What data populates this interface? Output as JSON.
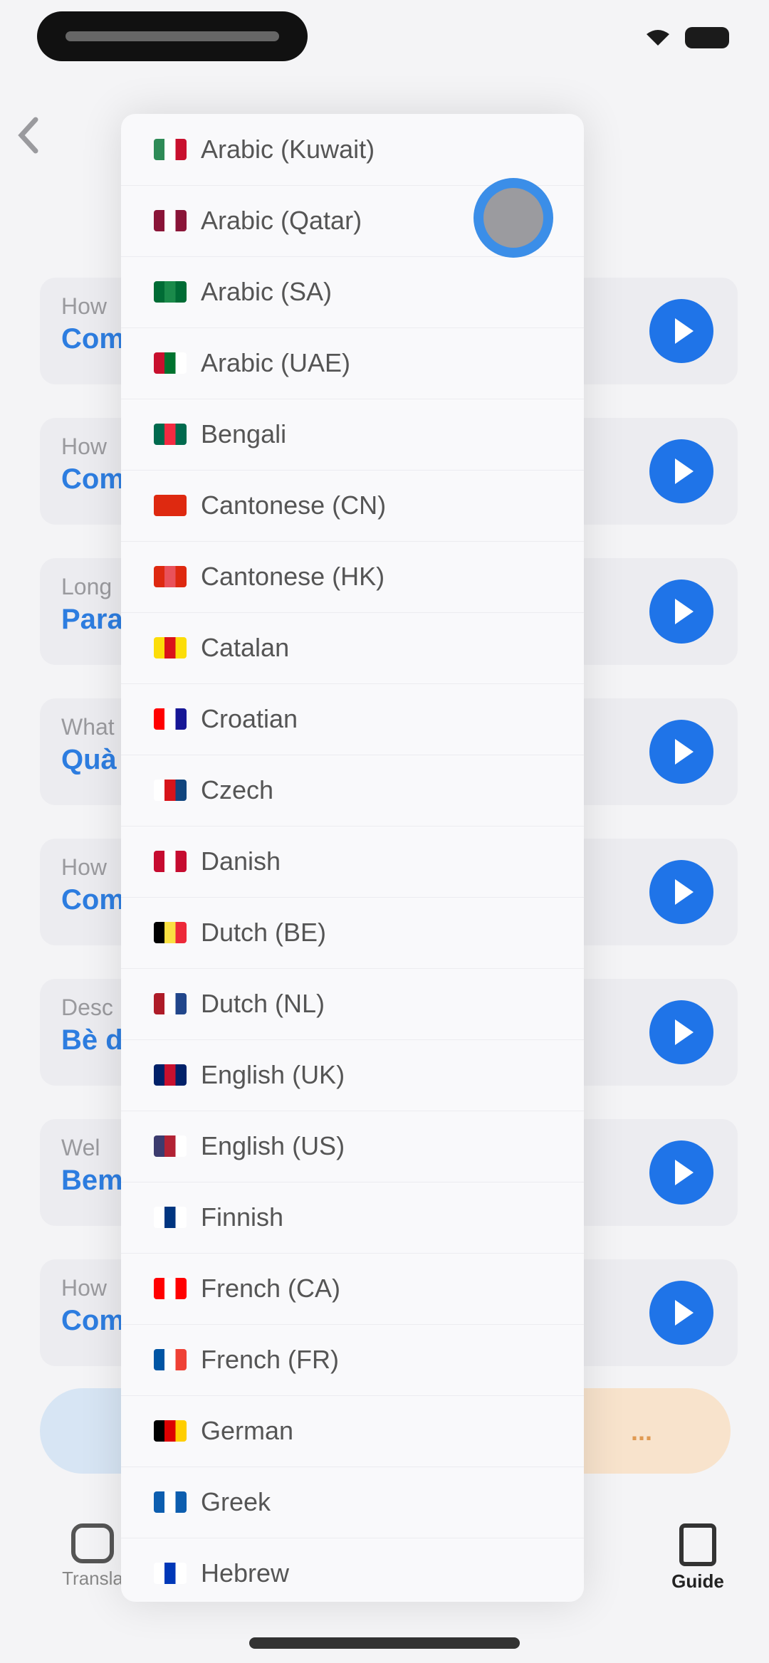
{
  "colors": {
    "accent": "#1f74e8",
    "link": "#2d7de0",
    "orange": "#e09a52"
  },
  "background_list": [
    {
      "sub": "How",
      "link": "Com"
    },
    {
      "sub": "How",
      "link": "Com"
    },
    {
      "sub": "Long",
      "link": "Para"
    },
    {
      "sub": "What",
      "link": "Quà"
    },
    {
      "sub": "How",
      "link": "Com"
    },
    {
      "sub": "Desc",
      "link": "Bè d"
    },
    {
      "sub": "Wel",
      "link": "Bem"
    },
    {
      "sub": "How",
      "link": "Com"
    }
  ],
  "bottom_right_label": "...",
  "tabbar": {
    "left_label": "Transla",
    "right_label": "Guide"
  },
  "languages": [
    {
      "label": "Arabic (Kuwait)",
      "flag_colors": [
        "#2e8b57",
        "#ffffff",
        "#c8102e"
      ]
    },
    {
      "label": "Arabic (Qatar)",
      "flag_colors": [
        "#8a1538",
        "#ffffff",
        "#8a1538"
      ]
    },
    {
      "label": "Arabic (SA)",
      "flag_colors": [
        "#006c35",
        "#1a8a4a",
        "#006c35"
      ]
    },
    {
      "label": "Arabic (UAE)",
      "flag_colors": [
        "#c8102e",
        "#00732f",
        "#ffffff"
      ]
    },
    {
      "label": "Bengali",
      "flag_colors": [
        "#006a4e",
        "#f42a41",
        "#006a4e"
      ]
    },
    {
      "label": "Cantonese (CN)",
      "flag_colors": [
        "#de2910",
        "#de2910",
        "#de2910"
      ]
    },
    {
      "label": "Cantonese (HK)",
      "flag_colors": [
        "#de2910",
        "#e9515a",
        "#de2910"
      ]
    },
    {
      "label": "Catalan",
      "flag_colors": [
        "#fcdd09",
        "#da121a",
        "#fcdd09"
      ]
    },
    {
      "label": "Croatian",
      "flag_colors": [
        "#ff0000",
        "#ffffff",
        "#171796"
      ]
    },
    {
      "label": "Czech",
      "flag_colors": [
        "#ffffff",
        "#d7141a",
        "#11457e"
      ]
    },
    {
      "label": "Danish",
      "flag_colors": [
        "#c60c30",
        "#ffffff",
        "#c60c30"
      ]
    },
    {
      "label": "Dutch (BE)",
      "flag_colors": [
        "#000000",
        "#fae042",
        "#ed2939"
      ]
    },
    {
      "label": "Dutch (NL)",
      "flag_colors": [
        "#ae1c28",
        "#ffffff",
        "#21468b"
      ]
    },
    {
      "label": "English (UK)",
      "flag_colors": [
        "#012169",
        "#c8102e",
        "#012169"
      ]
    },
    {
      "label": "English (US)",
      "flag_colors": [
        "#3c3b6e",
        "#b22234",
        "#ffffff"
      ]
    },
    {
      "label": "Finnish",
      "flag_colors": [
        "#ffffff",
        "#003580",
        "#ffffff"
      ]
    },
    {
      "label": "French (CA)",
      "flag_colors": [
        "#ff0000",
        "#ffffff",
        "#ff0000"
      ]
    },
    {
      "label": "French (FR)",
      "flag_colors": [
        "#0055a4",
        "#ffffff",
        "#ef4135"
      ]
    },
    {
      "label": "German",
      "flag_colors": [
        "#000000",
        "#dd0000",
        "#ffce00"
      ]
    },
    {
      "label": "Greek",
      "flag_colors": [
        "#0d5eaf",
        "#ffffff",
        "#0d5eaf"
      ]
    },
    {
      "label": "Hebrew",
      "flag_colors": [
        "#ffffff",
        "#0038b8",
        "#ffffff"
      ]
    }
  ]
}
